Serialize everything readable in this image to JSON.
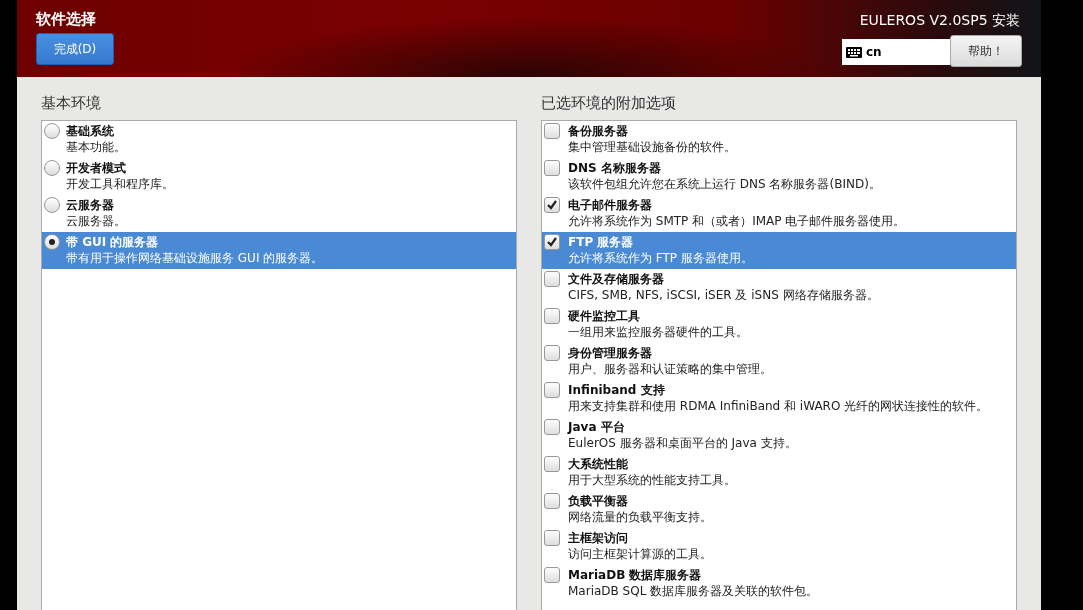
{
  "header": {
    "title": "软件选择",
    "done_button": "完成(D)",
    "product": "EULEROS V2.0SP5 安装",
    "keyboard_layout": "cn",
    "help_button": "帮助！"
  },
  "base_environment": {
    "heading": "基本环境",
    "items": [
      {
        "name": "基础系统",
        "description": "基本功能。",
        "selected": false
      },
      {
        "name": "开发者模式",
        "description": "开发工具和程序库。",
        "selected": false
      },
      {
        "name": "云服务器",
        "description": "云服务器。",
        "selected": false
      },
      {
        "name": "带 GUI 的服务器",
        "description": "带有用于操作网络基础设施服务 GUI 的服务器。",
        "selected": true
      }
    ]
  },
  "addons": {
    "heading": "已选环境的附加选项",
    "items": [
      {
        "name": "备份服务器",
        "description": "集中管理基础设施备份的软件。",
        "checked": false,
        "selected": false
      },
      {
        "name": "DNS 名称服务器",
        "description": "该软件包组允许您在系统上运行 DNS 名称服务器(BIND)。",
        "checked": false,
        "selected": false
      },
      {
        "name": "电子邮件服务器",
        "description": "允许将系统作为 SMTP 和（或者）IMAP 电子邮件服务器使用。",
        "checked": true,
        "selected": false
      },
      {
        "name": "FTP 服务器",
        "description": "允许将系统作为 FTP 服务器使用。",
        "checked": true,
        "selected": true
      },
      {
        "name": "文件及存储服务器",
        "description": "CIFS, SMB, NFS, iSCSI, iSER 及 iSNS 网络存储服务器。",
        "checked": false,
        "selected": false
      },
      {
        "name": "硬件监控工具",
        "description": "一组用来监控服务器硬件的工具。",
        "checked": false,
        "selected": false
      },
      {
        "name": "身份管理服务器",
        "description": "用户、服务器和认证策略的集中管理。",
        "checked": false,
        "selected": false
      },
      {
        "name": "Infiniband 支持",
        "description": "用来支持集群和使用 RDMA InfiniBand 和 iWARO 光纤的网状连接性的软件。",
        "checked": false,
        "selected": false
      },
      {
        "name": "Java 平台",
        "description": "EulerOS 服务器和桌面平台的 Java 支持。",
        "checked": false,
        "selected": false
      },
      {
        "name": "大系统性能",
        "description": "用于大型系统的性能支持工具。",
        "checked": false,
        "selected": false
      },
      {
        "name": "负载平衡器",
        "description": "网络流量的负载平衡支持。",
        "checked": false,
        "selected": false
      },
      {
        "name": "主框架访问",
        "description": "访问主框架计算源的工具。",
        "checked": false,
        "selected": false
      },
      {
        "name": "MariaDB 数据库服务器",
        "description": "MariaDB SQL 数据库服务器及关联的软件包。",
        "checked": false,
        "selected": false
      }
    ]
  }
}
